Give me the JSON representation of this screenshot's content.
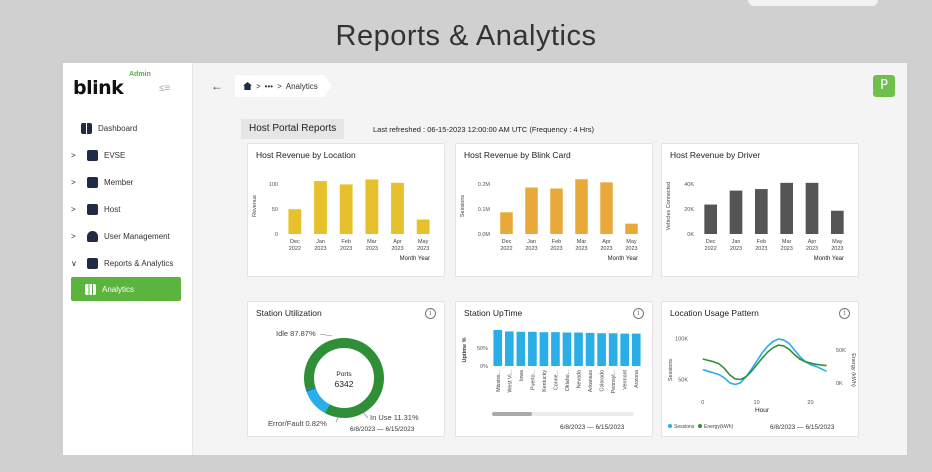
{
  "slide_title": "Reports & Analytics",
  "sidebar": {
    "logo": "blink",
    "admin_tag": "Admin",
    "collapse_icon": "≤≡",
    "items": [
      {
        "label": "Dashboard",
        "icon": "dashboard-icon",
        "chevron": ""
      },
      {
        "label": "EVSE",
        "icon": "evse-icon",
        "chevron": ">"
      },
      {
        "label": "Member",
        "icon": "member-icon",
        "chevron": ">"
      },
      {
        "label": "Host",
        "icon": "host-icon",
        "chevron": ">"
      },
      {
        "label": "User Management",
        "icon": "users-icon",
        "chevron": ">"
      },
      {
        "label": "Reports & Analytics",
        "icon": "reports-icon",
        "chevron": "∨"
      },
      {
        "label": "Analytics",
        "icon": "analytics-icon",
        "chevron": ""
      }
    ]
  },
  "header": {
    "back": "←",
    "breadcrumb_ellipsis": "•••",
    "breadcrumb_sep": ">",
    "breadcrumb_current": "Analytics",
    "avatar": "P"
  },
  "report": {
    "title": "Host Portal Reports",
    "refreshed": "Last refreshed : 06-15-2023 12:00:00 AM UTC (Frequency : 4 Hrs)"
  },
  "colors": {
    "brand_green": "#5ab43e",
    "yellow": "#e7c12b",
    "orange": "#e9a83a",
    "dark": "#555555",
    "blue": "#29aee8",
    "green_ring": "#2e8f37"
  },
  "cards": {
    "loc": {
      "title": "Host Revenue by Location"
    },
    "card": {
      "title": "Host Revenue by Blink Card"
    },
    "driver": {
      "title": "Host Revenue by Driver"
    },
    "util": {
      "title": "Station Utilization",
      "date_start": "6/8/2023",
      "date_sep": "—",
      "date_end": "6/15/2023"
    },
    "uptime": {
      "title": "Station UpTime",
      "date_start": "6/8/2023",
      "date_sep": "—",
      "date_end": "6/15/2023"
    },
    "usage": {
      "title": "Location Usage Pattern",
      "date_start": "6/8/2023",
      "date_sep": "—",
      "date_end": "6/15/2023"
    },
    "info_icon": "i"
  },
  "chart_data": [
    {
      "type": "bar",
      "title": "Host Revenue by Location",
      "xlabel": "Month Year",
      "ylabel": "Revenue",
      "yticks": [
        "0",
        "50",
        "100"
      ],
      "ylim": [
        0,
        150
      ],
      "categories": [
        [
          "Dec",
          "2022"
        ],
        [
          "Jan",
          "2023"
        ],
        [
          "Feb",
          "2023"
        ],
        [
          "Mar",
          "2023"
        ],
        [
          "Apr",
          "2023"
        ],
        [
          "May",
          "2023"
        ]
      ],
      "values": [
        60,
        128,
        120,
        132,
        124,
        35
      ],
      "color": "#e7c12b"
    },
    {
      "type": "bar",
      "title": "Host Revenue by Blink Card",
      "xlabel": "Month Year",
      "ylabel": "Sessions",
      "yticks": [
        "0.0M",
        "0.1M",
        "0.2M"
      ],
      "ylim": [
        0,
        0.3
      ],
      "categories": [
        [
          "Dec",
          "2022"
        ],
        [
          "Jan",
          "2023"
        ],
        [
          "Feb",
          "2023"
        ],
        [
          "Mar",
          "2023"
        ],
        [
          "Apr",
          "2023"
        ],
        [
          "May",
          "2023"
        ]
      ],
      "values": [
        0.105,
        0.225,
        0.22,
        0.265,
        0.25,
        0.05
      ],
      "color": "#e9a83a"
    },
    {
      "type": "bar",
      "title": "Host Revenue by Driver",
      "xlabel": "Month Year",
      "ylabel": "Vehicles Connected",
      "yticks": [
        "0K",
        "20K",
        "40K"
      ],
      "ylim": [
        0,
        40
      ],
      "categories": [
        [
          "Dec",
          "2022"
        ],
        [
          "Jan",
          "2023"
        ],
        [
          "Feb",
          "2023"
        ],
        [
          "Mar",
          "2023"
        ],
        [
          "Apr",
          "2023"
        ],
        [
          "May",
          "2023"
        ]
      ],
      "values": [
        19,
        28,
        29,
        33,
        33,
        15
      ],
      "color": "#555555"
    },
    {
      "type": "pie",
      "title": "Station Utilization",
      "center_label": "Ports",
      "center_value": "6342",
      "slices": [
        {
          "label": "Idle",
          "value": 87.87,
          "text": "Idle 87.87%",
          "color": "#2e8f37"
        },
        {
          "label": "In Use",
          "value": 11.31,
          "text": "In Use 11.31%",
          "color": "#29aee8"
        },
        {
          "label": "Error/Fault",
          "value": 0.82,
          "text": "Error/Fault 0.82%",
          "color": "#1b6fb5"
        }
      ]
    },
    {
      "type": "bar",
      "title": "Station UpTime",
      "ylabel": "Uptime %",
      "yticks": [
        "0%",
        "50%"
      ],
      "ylim": [
        0,
        100
      ],
      "categories": [
        "Mississ...",
        "West Vi...",
        "Iowa",
        "Puerto...",
        "Kentucky",
        "Conne...",
        "Oklaho...",
        "Nevada",
        "Arkansas",
        "Colorado",
        "Pennsyl...",
        "Vermont",
        "Arizona"
      ],
      "values": [
        100,
        96,
        95,
        95,
        94,
        94,
        93,
        93,
        92,
        91,
        91,
        90,
        90
      ],
      "color": "#29aee8"
    },
    {
      "type": "line",
      "title": "Location Usage Pattern",
      "xlabel": "Hour",
      "ylabel": "Sessions",
      "y2label": "Energy (kWh)",
      "xticks": [
        "0",
        "10",
        "20"
      ],
      "xlim": [
        -2,
        24
      ],
      "yticks": [
        "50K",
        "100K"
      ],
      "ylim": [
        30,
        110
      ],
      "y2ticks": [
        "0K",
        "50K"
      ],
      "y2lim": [
        -20,
        80
      ],
      "series": [
        {
          "name": "Sessions",
          "axis": "left",
          "color": "#29aee8",
          "x": [
            0,
            1,
            2,
            3,
            4,
            5,
            6,
            7,
            8,
            9,
            10,
            11,
            12,
            13,
            14,
            15,
            16,
            17,
            18,
            19,
            20,
            21,
            22,
            23
          ],
          "values": [
            62,
            60,
            58,
            56,
            52,
            46,
            44,
            46,
            53,
            62,
            72,
            82,
            90,
            96,
            99,
            98,
            94,
            86,
            78,
            72,
            68,
            66,
            63,
            60
          ]
        },
        {
          "name": "Energy (kWh)",
          "axis": "right",
          "color": "#2e8f37",
          "x": [
            0,
            1,
            2,
            3,
            4,
            5,
            6,
            7,
            8,
            9,
            10,
            11,
            12,
            13,
            14,
            15,
            16,
            17,
            18,
            19,
            20,
            21,
            22,
            23
          ],
          "values": [
            36,
            34,
            32,
            29,
            22,
            12,
            6,
            5,
            9,
            17,
            27,
            37,
            46,
            53,
            57,
            56,
            51,
            43,
            36,
            32,
            30,
            28,
            27,
            26
          ]
        }
      ]
    }
  ]
}
